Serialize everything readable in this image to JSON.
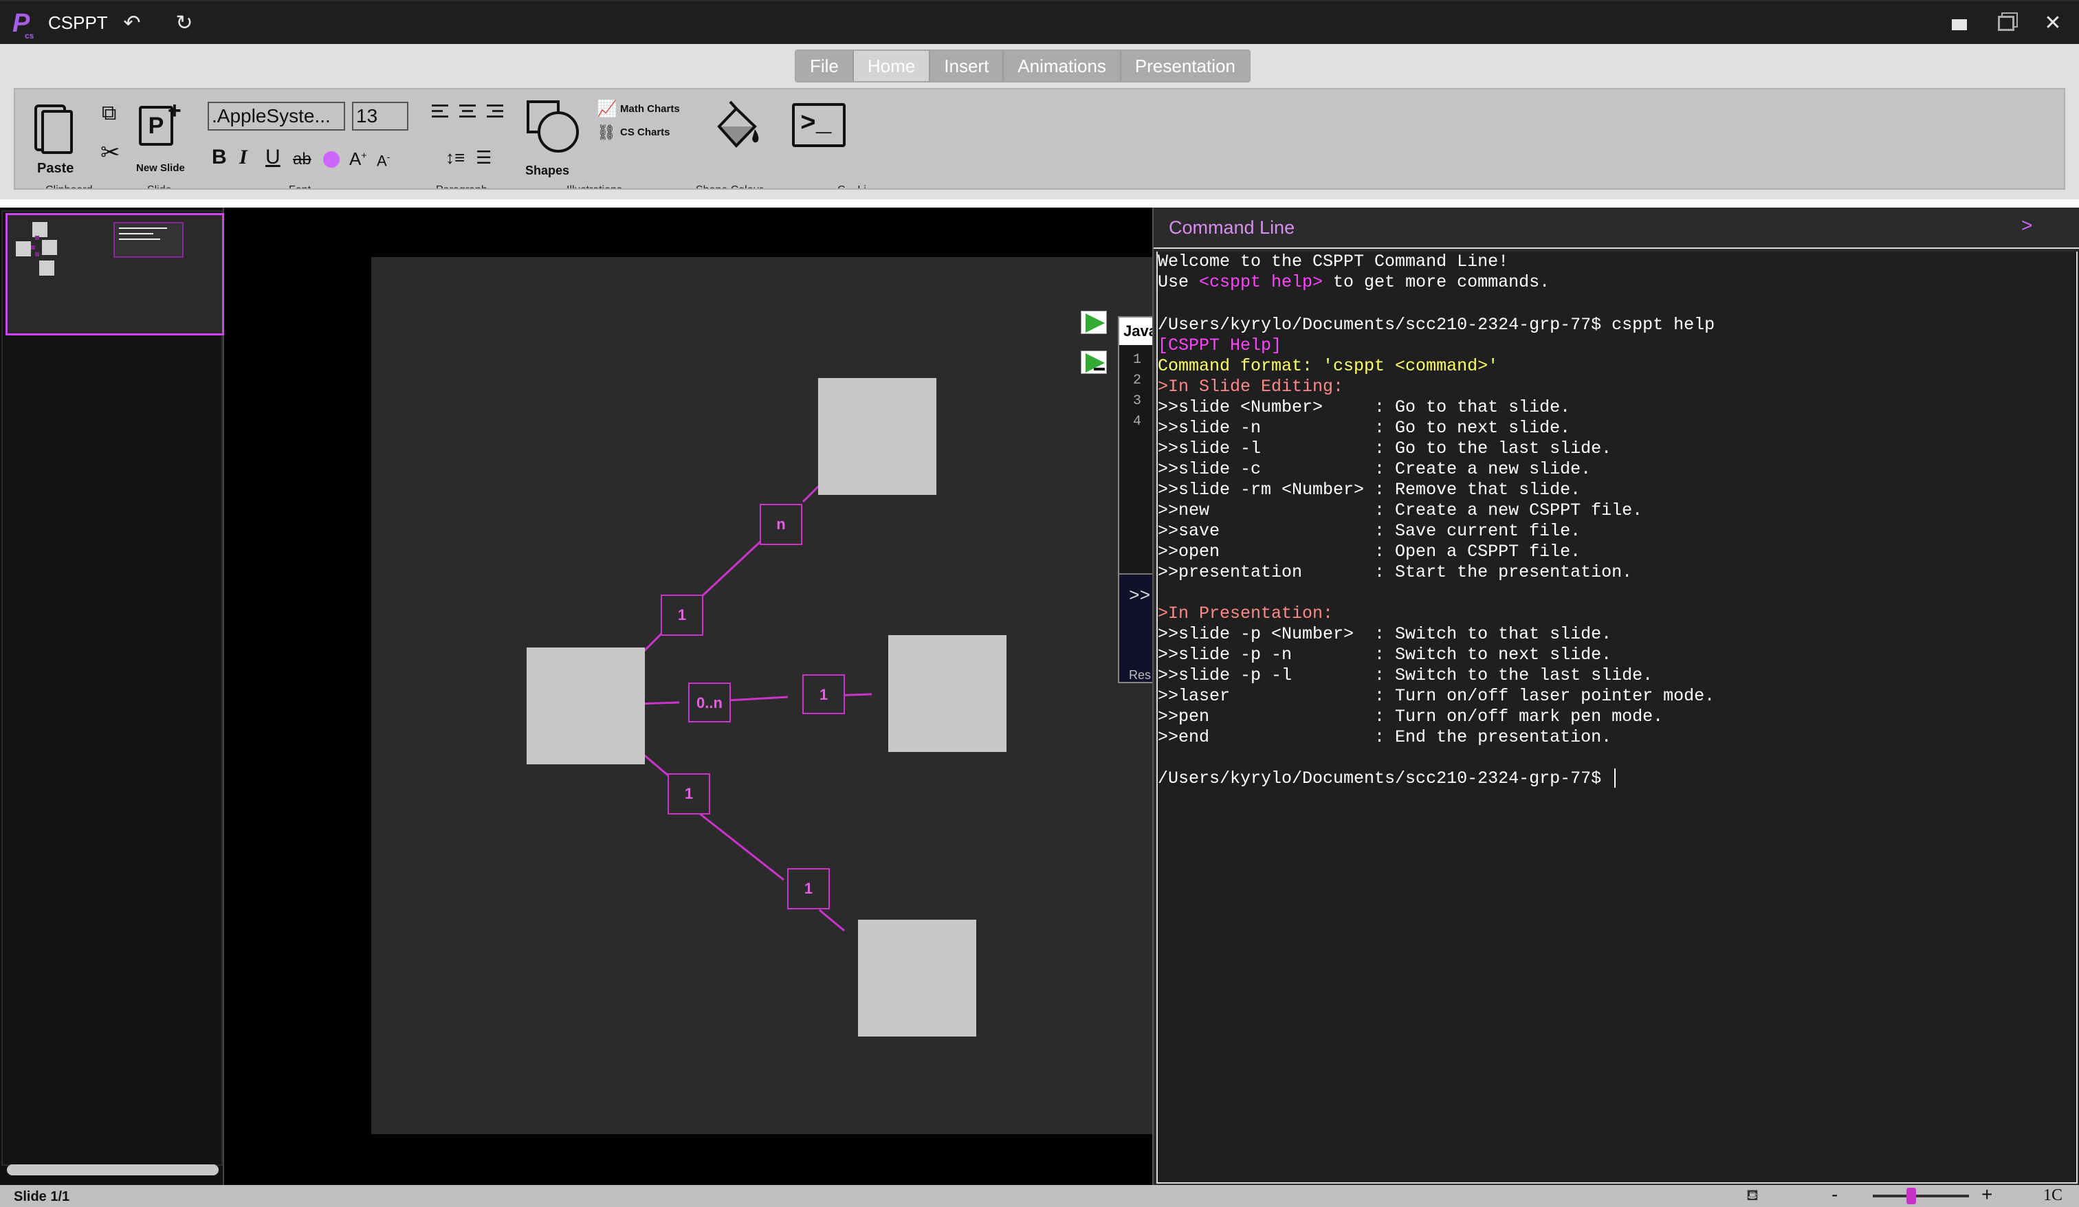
{
  "app": {
    "title": "CSPPT",
    "logo": "P"
  },
  "menu": {
    "tabs": [
      "File",
      "Home",
      "Insert",
      "Animations",
      "Presentation"
    ],
    "active": "Home"
  },
  "ribbon": {
    "paste_label": "Paste",
    "new_slide_label": "New Slide",
    "font_name": ".AppleSyste...",
    "font_size": "13",
    "shapes_label": "Shapes",
    "math_charts_label": "Math Charts",
    "cs_charts_label": "CS Charts",
    "text_color": "#cc66ff",
    "groups": [
      "Clipboard",
      "Slide",
      "Font",
      "Paragraph",
      "Illustrations",
      "Shape Colour",
      "C...  Li..."
    ]
  },
  "slide_diagram": {
    "labels": [
      "n",
      "1",
      "0..n",
      "1",
      "1",
      "1"
    ],
    "line_color": "#cc33cc",
    "box_color": "#c8c8c8"
  },
  "code_block": {
    "language": "Java",
    "line_numbers": [
      "1",
      "2",
      "3",
      "4"
    ],
    "prompt": ">>",
    "result_label": "Res"
  },
  "command_line": {
    "title": "Command Line",
    "collapse_icon": ">",
    "welcome": "Welcome to the CSPPT Command Line!",
    "help_hint_prefix": "Use ",
    "help_hint_cmd": "<csppt help>",
    "help_hint_suffix": " to get more commands.",
    "prompt_1": "/Users/kyrylo/Documents/scc210-2324-grp-77$ csppt help",
    "help_title": "[CSPPT Help]",
    "format": "Command format: 'csppt <command>'",
    "slide_editing_header": ">In Slide Editing:",
    "slide_editing_cmds": [
      ">>slide <Number>     : Go to that slide.",
      ">>slide -n           : Go to next slide.",
      ">>slide -l           : Go to the last slide.",
      ">>slide -c           : Create a new slide.",
      ">>slide -rm <Number> : Remove that slide.",
      ">>new                : Create a new CSPPT file.",
      ">>save               : Save current file.",
      ">>open               : Open a CSPPT file.",
      ">>presentation       : Start the presentation."
    ],
    "presentation_header": ">In Presentation:",
    "presentation_cmds": [
      ">>slide -p <Number>  : Switch to that slide.",
      ">>slide -p -n        : Switch to next slide.",
      ">>slide -p -l        : Switch to the last slide.",
      ">>laser              : Turn on/off laser pointer mode.",
      ">>pen                : Turn on/off mark pen mode.",
      ">>end                : End the presentation."
    ],
    "prompt_2": "/Users/kyrylo/Documents/scc210-2324-grp-77$ "
  },
  "status": {
    "slide_indicator": "Slide 1/1",
    "zoom_out": "-",
    "zoom_in": "+",
    "zoom_level": "1C",
    "zoom_fraction": 0.4
  }
}
